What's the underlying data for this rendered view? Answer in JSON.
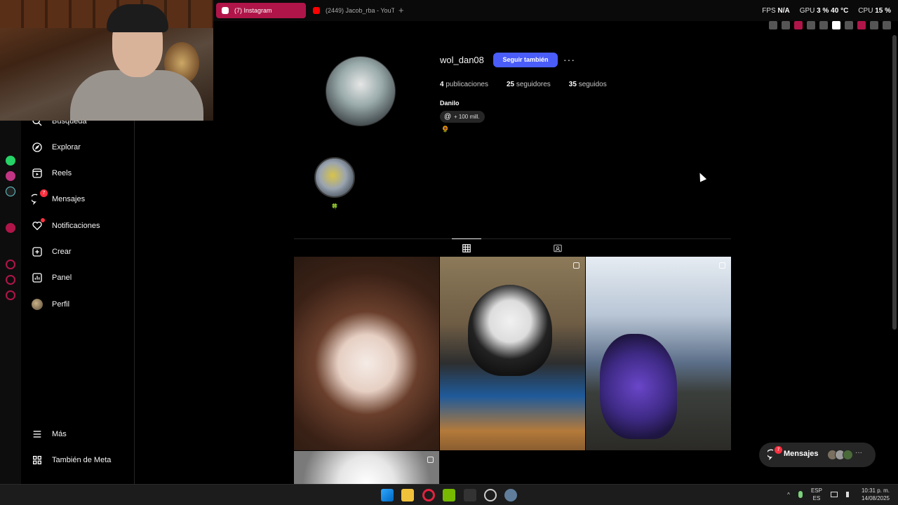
{
  "browser": {
    "tabs": [
      {
        "label": "(7) Instagram"
      },
      {
        "label": "(2449) Jacob_rba - YouTu"
      }
    ],
    "new_tab": "+"
  },
  "hud": {
    "fps_label": "FPS",
    "fps_value": "N/A",
    "gpu_label": "GPU",
    "gpu_value": "3 %",
    "gpu_temp": "40 °C",
    "cpu_label": "CPU",
    "cpu_value": "15 %"
  },
  "nav": {
    "search": "Búsqueda",
    "explore": "Explorar",
    "reels": "Reels",
    "messages": "Mensajes",
    "messages_badge": "7",
    "notifications": "Notificaciones",
    "create": "Crear",
    "panel": "Panel",
    "profile": "Perfil",
    "more": "Más",
    "meta": "También de Meta"
  },
  "profile": {
    "username": "wol_dan08",
    "follow_button": "Seguir también",
    "more": "···",
    "posts_count": "4",
    "posts_label": "publicaciones",
    "followers_count": "25",
    "followers_label": "seguidores",
    "following_count": "35",
    "following_label": "seguidos",
    "full_name": "Danilo",
    "threads_badge": "+ 100 mill.",
    "bio_emoji": "🌻",
    "highlight_label": "🍀"
  },
  "messages_pill": {
    "label": "Mensajes",
    "badge": "7",
    "more": "···"
  },
  "taskbar": {
    "lang_top": "ESP",
    "lang_bottom": "ES",
    "time": "10:31 p. m.",
    "date": "14/08/2025",
    "tray_chevron": "^"
  },
  "colors": {
    "follow": "#4a5df9",
    "active_tab": "#b0154a",
    "badge": "#ff3040"
  }
}
